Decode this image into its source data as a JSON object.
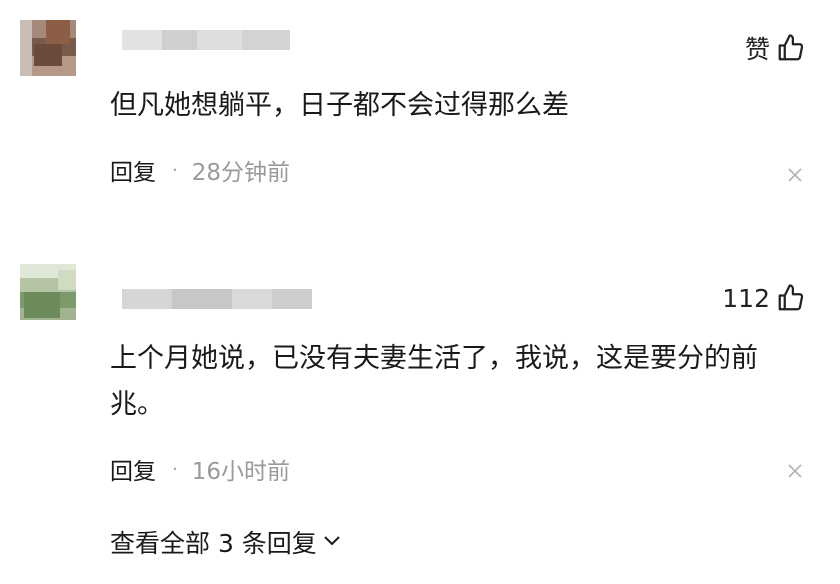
{
  "comments": [
    {
      "likes": "赞",
      "text": "但凡她想躺平，日子都不会过得那么差",
      "reply_label": "回复",
      "separator": "·",
      "time": "28分钟前"
    },
    {
      "likes": "112",
      "text": "上个月她说，已没有夫妻生活了，我说，这是要分的前兆。",
      "reply_label": "回复",
      "separator": "·",
      "time": "16小时前"
    }
  ],
  "view_replies": {
    "label": "查看全部 3 条回复",
    "icon": "chevron-down-icon"
  },
  "icons": {
    "like": "thumbs-up-icon",
    "dismiss": "close-icon"
  },
  "colors": {
    "text": "#1a1a1a",
    "meta": "#9a9a9a",
    "background": "#ffffff"
  }
}
